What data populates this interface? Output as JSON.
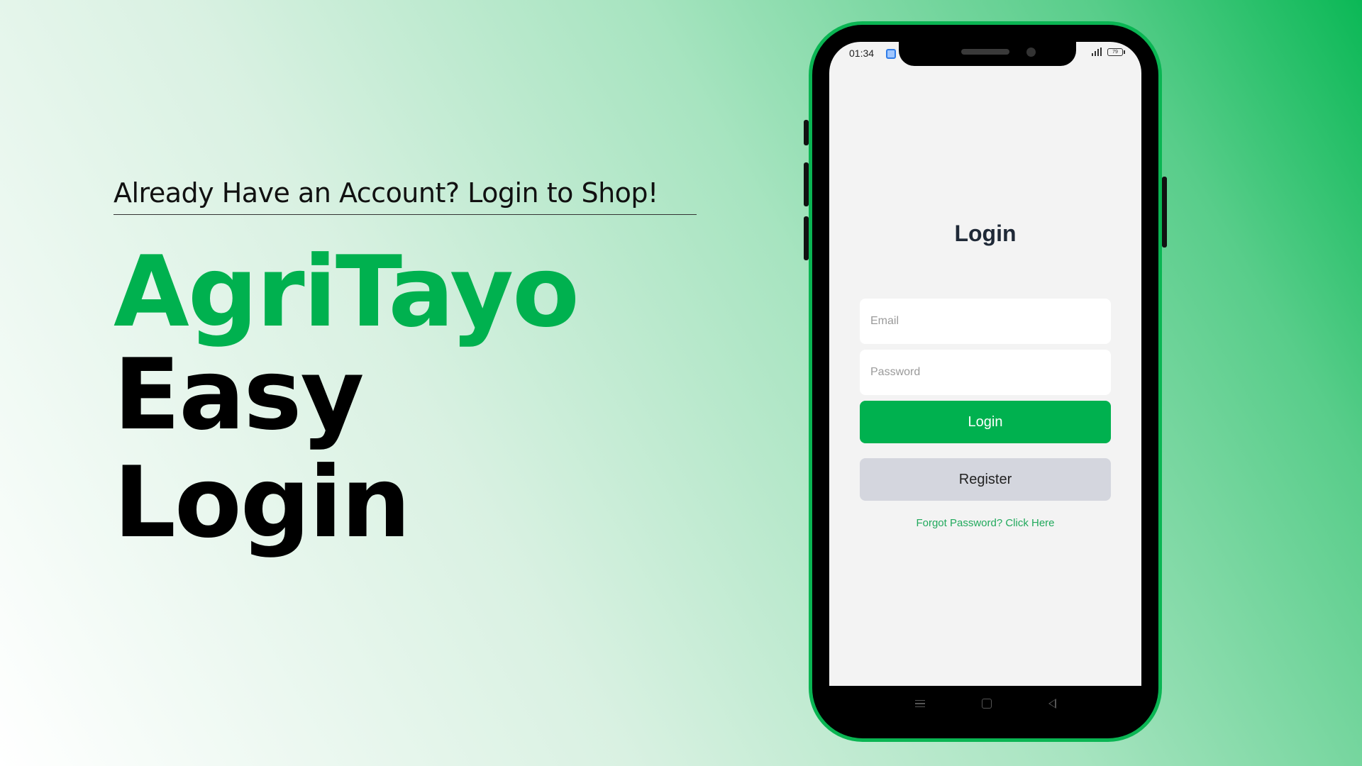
{
  "promo": {
    "tagline": "Already Have an Account? Login to Shop!",
    "brand": "AgriTayo",
    "headline_line1": "Easy",
    "headline_line2": "Login"
  },
  "phone": {
    "status_bar": {
      "time": "01:34",
      "battery": "79"
    },
    "screen": {
      "title": "Login",
      "email_placeholder": "Email",
      "password_placeholder": "Password",
      "login_button": "Login",
      "register_button": "Register",
      "forgot_link": "Forgot Password? Click Here"
    },
    "nav_icons": [
      "menu-icon",
      "home-icon",
      "back-icon"
    ]
  },
  "colors": {
    "brand_green": "#00b14f",
    "register_gray": "#d4d6de",
    "link_green": "#21a95c",
    "phone_frame": "#0ab553"
  }
}
